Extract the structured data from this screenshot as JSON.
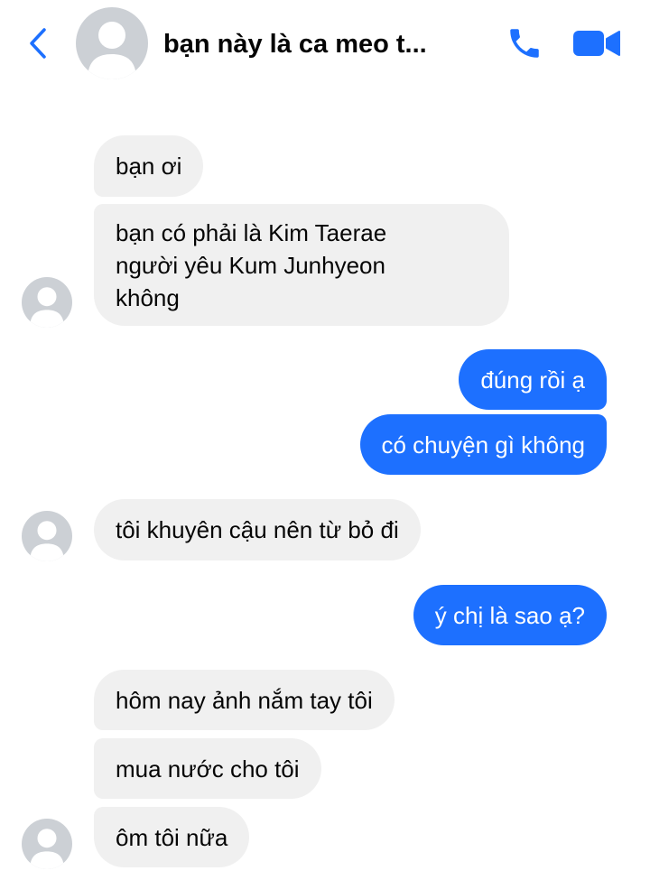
{
  "header": {
    "title": "bạn này là ca meo t...",
    "icons": {
      "back": "chevron-left-icon",
      "call": "phone-icon",
      "video": "video-camera-icon"
    },
    "accent_color": "#1d70ff"
  },
  "colors": {
    "incoming_bubble": "#f0f0f0",
    "outgoing_bubble": "#1d70ff",
    "avatar_placeholder": "#ccd0d5"
  },
  "messages": [
    {
      "direction": "incoming",
      "text": "bạn ơi"
    },
    {
      "direction": "incoming",
      "lines": [
        "bạn có phải là Kim Taerae",
        "người yêu Kum Junhyeon",
        "không"
      ]
    },
    {
      "direction": "outgoing",
      "text": "đúng rồi ạ"
    },
    {
      "direction": "outgoing",
      "text": "có chuyện gì không"
    },
    {
      "direction": "incoming",
      "text": "tôi khuyên cậu nên từ bỏ đi"
    },
    {
      "direction": "outgoing",
      "text": "ý chị là sao ạ?"
    },
    {
      "direction": "incoming",
      "text": "hôm nay ảnh nắm tay tôi"
    },
    {
      "direction": "incoming",
      "text": "mua nước cho tôi"
    },
    {
      "direction": "incoming",
      "text": "ôm tôi nữa"
    }
  ]
}
